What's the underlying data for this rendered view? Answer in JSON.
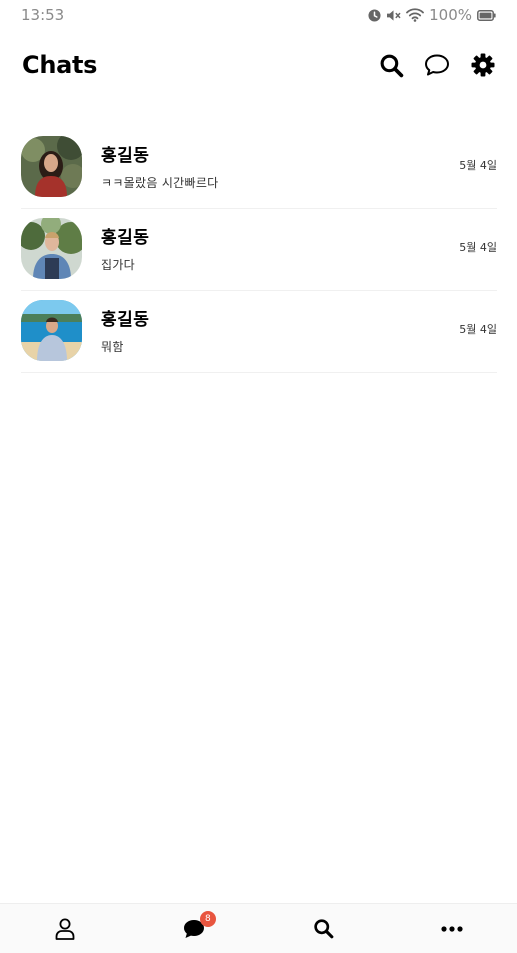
{
  "status_bar": {
    "time": "13:53",
    "icons": [
      "alarm-icon",
      "mute-icon",
      "wifi-icon"
    ],
    "battery_text": "100%"
  },
  "header": {
    "title": "Chats",
    "actions": [
      "search-icon",
      "new-chat-icon",
      "settings-icon"
    ]
  },
  "chats": [
    {
      "name": "홍길동",
      "message": "ㅋㅋ몰랐음 시간빠르다",
      "date": "5월 4일"
    },
    {
      "name": "홍길동",
      "message": "집가다",
      "date": "5월 4일"
    },
    {
      "name": "홍길동",
      "message": "뭐함",
      "date": "5월 4일"
    }
  ],
  "bottom_nav": {
    "items": [
      "profile-icon",
      "chats-icon",
      "search-icon",
      "more-icon"
    ],
    "chats_badge": "8",
    "badge_color": "#e8553f"
  }
}
